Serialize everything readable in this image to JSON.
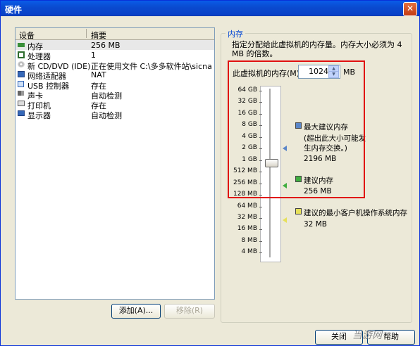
{
  "window": {
    "title": "硬件",
    "close_glyph": "✕"
  },
  "device_list": {
    "headers": [
      "设备",
      "摘要"
    ],
    "rows": [
      {
        "name": "内存",
        "summary": "256 MB",
        "icon": "memory-icon",
        "color": "#3a8f3a"
      },
      {
        "name": "处理器",
        "summary": "1",
        "icon": "processor-icon",
        "color": "#2d6c2d"
      },
      {
        "name": "新 CD/DVD (IDE)",
        "summary": "正在使用文件 C:\\多多软件站\\sicnal...",
        "icon": "cd-dvd-icon",
        "color": "#888888"
      },
      {
        "name": "网络适配器",
        "summary": "NAT",
        "icon": "network-adapter-icon",
        "color": "#3568b8"
      },
      {
        "name": "USB 控制器",
        "summary": "存在",
        "icon": "usb-icon",
        "color": "#3568b8"
      },
      {
        "name": "声卡",
        "summary": "自动检测",
        "icon": "sound-card-icon",
        "color": "#666666"
      },
      {
        "name": "打印机",
        "summary": "存在",
        "icon": "printer-icon",
        "color": "#555555"
      },
      {
        "name": "显示器",
        "summary": "自动检测",
        "icon": "display-icon",
        "color": "#3568b8"
      }
    ]
  },
  "buttons": {
    "add": "添加(A)...",
    "remove": "移除(R)",
    "close": "关闭",
    "help": "帮助"
  },
  "memory": {
    "group_title": "内存",
    "description": "指定分配给此虚拟机的内存量。内存大小必须为 4 MB 的倍数。",
    "label": "此虚拟机的内存(M):",
    "value": "1024",
    "unit": "MB",
    "scale_labels": [
      "64 GB",
      "32 GB",
      "16 GB",
      "8 GB",
      "4 GB",
      "2 GB",
      "1 GB",
      "512 MB",
      "256 MB",
      "128 MB",
      "64 MB",
      "32 MB",
      "16 MB",
      "8 MB",
      "4 MB"
    ],
    "legend": {
      "max": {
        "title": "最大建议内存",
        "note": "(超出此大小可能发生内存交换。)",
        "value": "2196 MB",
        "color": "#5a86c8"
      },
      "recommended": {
        "title": "建议内存",
        "value": "256 MB",
        "color": "#3fae3f"
      },
      "min_guest": {
        "title": "建议的最小客户机操作系统内存",
        "value": "32 MB",
        "color": "#e6e05a"
      }
    }
  },
  "watermark": "当游网"
}
